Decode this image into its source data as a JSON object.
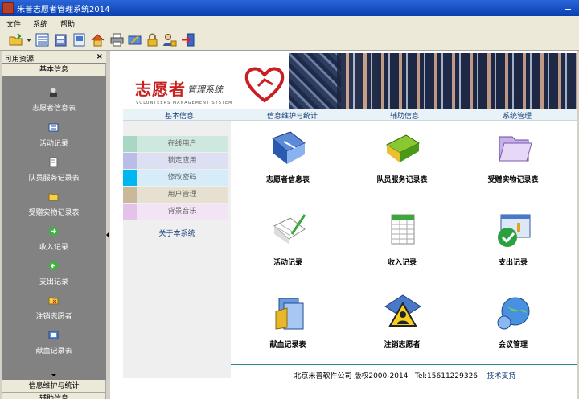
{
  "window": {
    "title": "米普志愿者管理系统2014"
  },
  "menu": [
    "文件",
    "系统",
    "帮助"
  ],
  "toolbar_icons": [
    "folder-open-icon",
    "list-icon",
    "database-icon",
    "report-icon",
    "home-icon",
    "printer-icon",
    "tools-icon",
    "lock-icon",
    "user-lock-icon",
    "exit-icon"
  ],
  "sidebar": {
    "header": "可用资源",
    "close": "×",
    "group_top": "基本信息",
    "items": [
      {
        "label": "志愿者信息表",
        "icon": "user-info-icon"
      },
      {
        "label": "活动记录",
        "icon": "activity-icon"
      },
      {
        "label": "队员服务记录表",
        "icon": "service-record-icon"
      },
      {
        "label": "受赠实物记录表",
        "icon": "donation-folder-icon"
      },
      {
        "label": "收入记录",
        "icon": "income-icon"
      },
      {
        "label": "支出记录",
        "icon": "expense-icon"
      },
      {
        "label": "注销志愿者",
        "icon": "cancel-volunteer-icon"
      },
      {
        "label": "献血记录表",
        "icon": "blood-donation-icon"
      }
    ],
    "group_bottom_1": "信息维护与统计",
    "group_bottom_2": "辅助信息"
  },
  "banner": {
    "title": "志愿者",
    "subtitle": "管理系统",
    "english": "VOLUNTEERS MANAGEMENT SYSTEM"
  },
  "nav": [
    "基本信息",
    "信息维护与统计",
    "辅助信息",
    "系统管理"
  ],
  "left_panel": {
    "items": [
      {
        "label": "在线用户",
        "color": "#cfe8df",
        "swatch": "#a8d8c4"
      },
      {
        "label": "锁定应用",
        "color": "#dde0f2",
        "swatch": "#b9bde8"
      },
      {
        "label": "修改密码",
        "color": "#d6ecf8",
        "swatch": "#00b6f0"
      },
      {
        "label": "用户管理",
        "color": "#e6e0d0",
        "swatch": "#c9b99a"
      },
      {
        "label": "背景音乐",
        "color": "#f2e4f4",
        "swatch": "#e4c2ea"
      }
    ],
    "about": "关于本系统"
  },
  "grid": [
    {
      "label": "志愿者信息表",
      "icon": "user-info-card-icon"
    },
    {
      "label": "队员服务记录表",
      "icon": "green-book-icon"
    },
    {
      "label": "受赠实物记录表",
      "icon": "purple-folder-icon"
    },
    {
      "label": "活动记录",
      "icon": "notepad-pen-icon"
    },
    {
      "label": "收入记录",
      "icon": "spreadsheet-icon"
    },
    {
      "label": "支出记录",
      "icon": "check-window-icon"
    },
    {
      "label": "献血记录表",
      "icon": "blood-folder-icon"
    },
    {
      "label": "注销志愿者",
      "icon": "users-warning-icon"
    },
    {
      "label": "会议管理",
      "icon": "globe-meeting-icon"
    }
  ],
  "footer": {
    "company": "北京米普软件公司 版权2000-2014",
    "tel": "Tel:15611229326",
    "support": "技术支持"
  }
}
